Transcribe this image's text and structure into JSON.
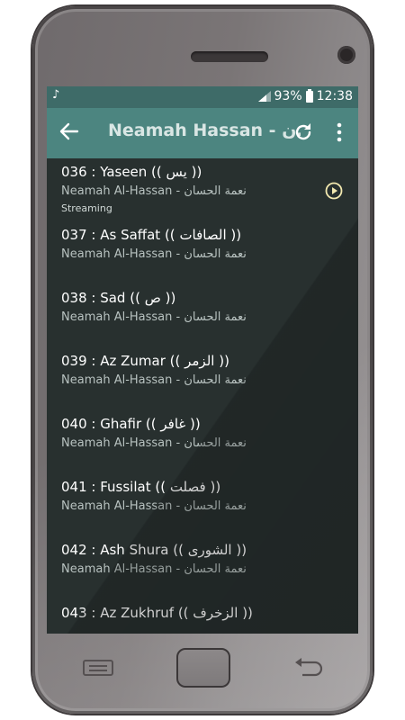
{
  "status_bar": {
    "battery": "93%",
    "time": "12:38",
    "icons": [
      "music-note-icon",
      "signal-icon",
      "battery-icon"
    ]
  },
  "toolbar": {
    "title": "Neamah Hassan - ن...",
    "icons": [
      "back-arrow-icon",
      "refresh-icon",
      "more-vert-icon"
    ]
  },
  "tracks": [
    {
      "title": "036 : Yaseen (( يس ))",
      "subtitle": "Neamah Al-Hassan - نعمة الحسان",
      "status": "Streaming"
    },
    {
      "title": "037 : As Saffat (( الصافات ))",
      "subtitle": "Neamah Al-Hassan - نعمة الحسان"
    },
    {
      "title": "038 : Sad (( ص ))",
      "subtitle": "Neamah Al-Hassan - نعمة الحسان"
    },
    {
      "title": "039 : Az Zumar (( الزمر ))",
      "subtitle": "Neamah Al-Hassan - نعمة الحسان"
    },
    {
      "title": "040 : Ghafir (( غافر ))",
      "subtitle": "Neamah Al-Hassan - نعمة الحسان"
    },
    {
      "title": "041 : Fussilat (( فصلت ))",
      "subtitle": "Neamah Al-Hassan - نعمة الحسان"
    },
    {
      "title": "042 : Ash Shura (( الشورى ))",
      "subtitle": "Neamah Al-Hassan - نعمة الحسان"
    },
    {
      "title": "043 : Az Zukhruf (( الزخرف ))",
      "subtitle": ""
    }
  ],
  "colors": {
    "statusbar": "#3e6b68",
    "toolbar": "#4c8580",
    "list_bg": "#28302f",
    "accent": "#f3e9b0"
  }
}
